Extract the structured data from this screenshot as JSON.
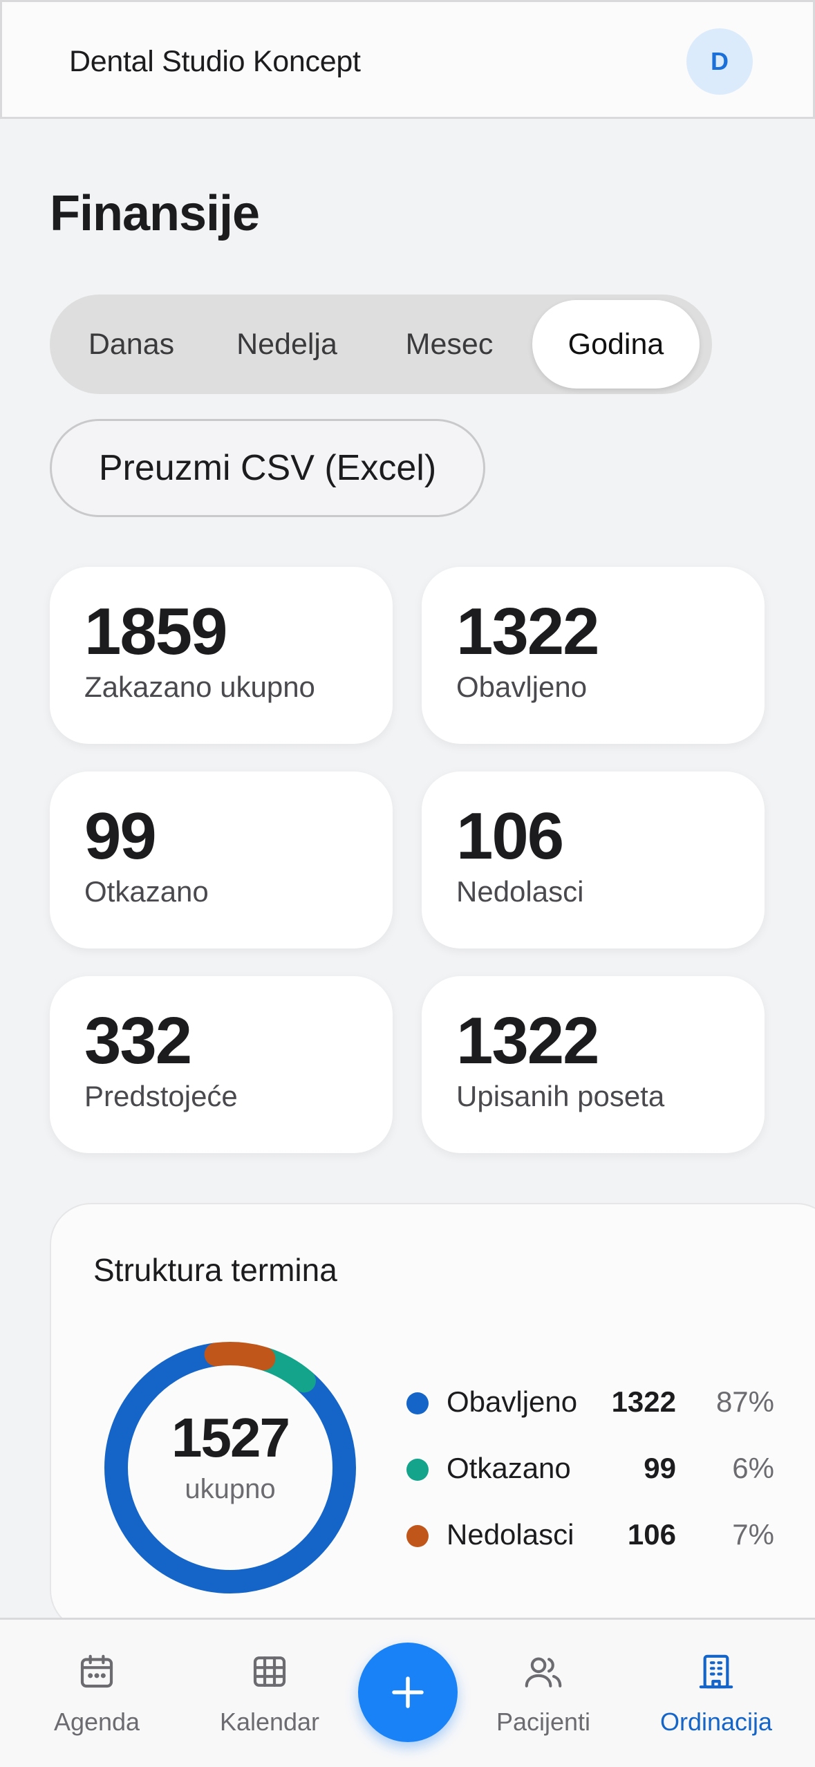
{
  "header": {
    "brand": "Dental Studio Koncept",
    "avatar_initial": "D"
  },
  "page": {
    "title": "Finansije"
  },
  "period_tabs": [
    {
      "label": "Danas",
      "selected": false
    },
    {
      "label": "Nedelja",
      "selected": false
    },
    {
      "label": "Mesec",
      "selected": false
    },
    {
      "label": "Godina",
      "selected": true
    }
  ],
  "export": {
    "label": "Preuzmi CSV (Excel)"
  },
  "stats": [
    {
      "value": "1859",
      "label": "Zakazano ukupno"
    },
    {
      "value": "1322",
      "label": "Obavljeno"
    },
    {
      "value": "99",
      "label": "Otkazano"
    },
    {
      "value": "106",
      "label": "Nedolasci"
    },
    {
      "value": "332",
      "label": "Predstojeće"
    },
    {
      "value": "1322",
      "label": "Upisanih poseta"
    }
  ],
  "structure": {
    "title": "Struktura termina",
    "total": "1527",
    "total_label": "ukupno",
    "legend": [
      {
        "name": "Obavljeno",
        "value": "1322",
        "percent": "87%",
        "color": "#1565c8"
      },
      {
        "name": "Otkazano",
        "value": "99",
        "percent": "6%",
        "color": "#14a38b"
      },
      {
        "name": "Nedolasci",
        "value": "106",
        "percent": "7%",
        "color": "#c0561a"
      }
    ]
  },
  "chart_data": {
    "type": "pie",
    "title": "Struktura termina",
    "categories": [
      "Obavljeno",
      "Otkazano",
      "Nedolasci"
    ],
    "values": [
      1322,
      99,
      106
    ],
    "percents": [
      87,
      6,
      7
    ],
    "colors": [
      "#1565c8",
      "#14a38b",
      "#c0561a"
    ],
    "center_value": 1527,
    "center_label": "ukupno",
    "legend": "right"
  },
  "bottom_nav": {
    "items": [
      {
        "label": "Agenda",
        "icon": "calendar-icon",
        "active": false
      },
      {
        "label": "Kalendar",
        "icon": "grid-icon",
        "active": false
      },
      {
        "label": "Pacijenti",
        "icon": "users-icon",
        "active": false
      },
      {
        "label": "Ordinacija",
        "icon": "building-icon",
        "active": true
      }
    ],
    "fab_icon": "plus-icon",
    "accent": "#1a82f7"
  }
}
